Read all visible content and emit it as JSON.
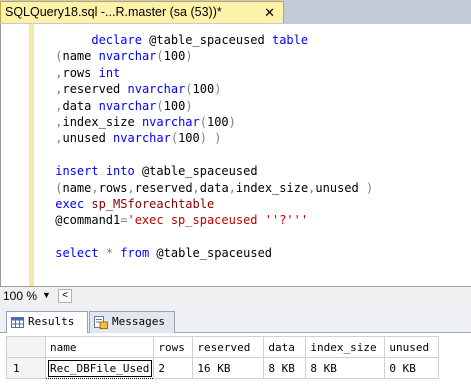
{
  "tab": {
    "title": "SQLQuery18.sql -...R.master (sa (53))*",
    "close": "✕"
  },
  "code_lines": [
    "      declare @table_spaceused table",
    " (name nvarchar(100)",
    " ,rows int",
    " ,reserved nvarchar(100)",
    " ,data nvarchar(100)",
    " ,index_size nvarchar(100)",
    " ,unused nvarchar(100) )",
    "",
    " insert into @table_spaceused",
    " (name,rows,reserved,data,index_size,unused )",
    " exec sp_MSforeachtable",
    " @command1='exec sp_spaceused ''?'''",
    "",
    " select * from @table_spaceused"
  ],
  "zoom": {
    "value": "100 %",
    "left_arrow": "<"
  },
  "result_tabs": {
    "results": "Results",
    "messages": "Messages"
  },
  "grid": {
    "columns": [
      "name",
      "rows",
      "reserved",
      "data",
      "index_size",
      "unused"
    ],
    "rows": [
      {
        "num": "1",
        "cells": [
          "Rec_DBFile_Used",
          "2",
          "16 KB",
          "8 KB",
          "8 KB",
          "0 KB"
        ]
      }
    ]
  },
  "colors": {
    "tab_bg": "#fdf2a8",
    "keyword": "#0000ff",
    "string": "#c00000",
    "sysproc": "#800000"
  },
  "icons": {
    "results": "grid-icon",
    "messages": "messages-icon"
  }
}
